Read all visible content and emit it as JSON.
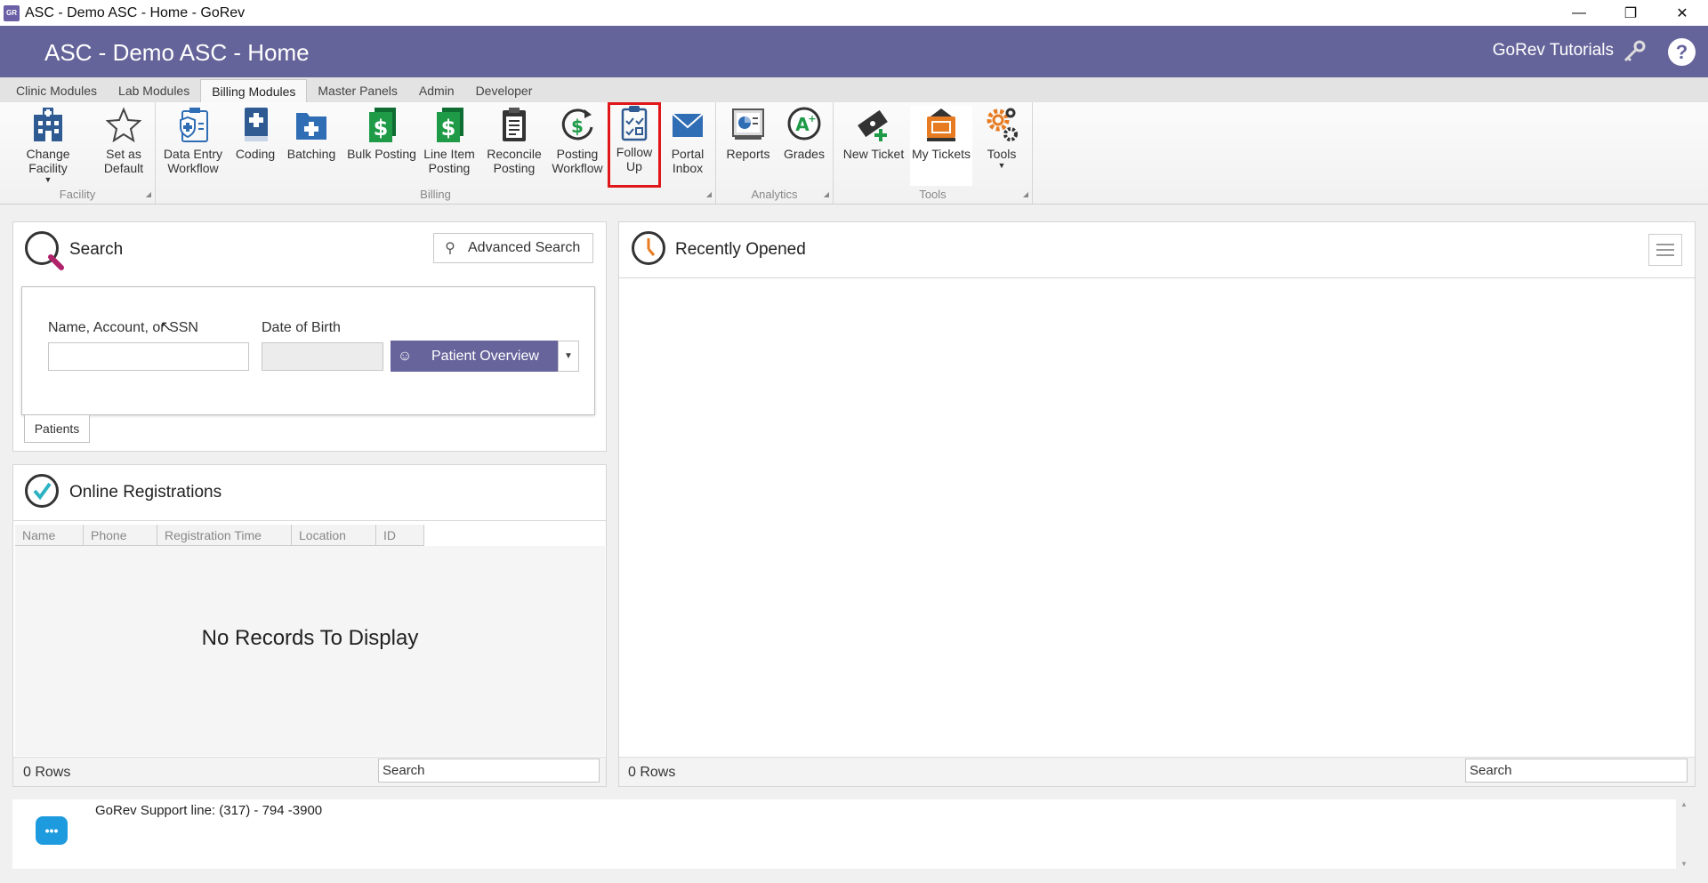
{
  "window": {
    "app_icon": "gorev-app-icon",
    "title": "ASC - Demo ASC - Home - GoRev",
    "controls": [
      "minimize-icon",
      "restore-icon",
      "close-icon"
    ]
  },
  "header": {
    "title": "ASC - Demo ASC - Home",
    "tutorials_label": "GoRev Tutorials",
    "help_label": "?"
  },
  "tabs": [
    {
      "label": "Clinic Modules",
      "active": false
    },
    {
      "label": "Lab Modules",
      "active": false
    },
    {
      "label": "Billing Modules",
      "active": true
    },
    {
      "label": "Master Panels",
      "active": false
    },
    {
      "label": "Admin",
      "active": false
    },
    {
      "label": "Developer",
      "active": false
    }
  ],
  "ribbon": {
    "groups": {
      "facility": "Facility",
      "billing": "Billing",
      "analytics": "Analytics",
      "tools": "Tools"
    },
    "buttons": {
      "change_facility": [
        "Change Facility"
      ],
      "set_default": [
        "Set as",
        "Default"
      ],
      "data_entry": [
        "Data Entry",
        "Workflow"
      ],
      "coding": [
        "Coding"
      ],
      "batching": [
        "Batching"
      ],
      "bulk_posting": [
        "Bulk Posting"
      ],
      "line_item": [
        "Line Item",
        "Posting"
      ],
      "reconcile": [
        "Reconcile",
        "Posting"
      ],
      "posting_workflow": [
        "Posting",
        "Workflow"
      ],
      "follow_up": [
        "Follow",
        "Up"
      ],
      "portal_inbox": [
        "Portal",
        "Inbox"
      ],
      "reports": [
        "Reports"
      ],
      "grades": [
        "Grades"
      ],
      "new_ticket": [
        "New Ticket"
      ],
      "my_tickets": [
        "My Tickets"
      ],
      "tools": [
        "Tools"
      ]
    },
    "highlighted": "follow_up"
  },
  "search_panel": {
    "title": "Search",
    "advanced_label": "Advanced Search",
    "name_label": "Name, Account, or SSN",
    "name_value": "",
    "dob_label": "Date of Birth",
    "dob_value": "",
    "patient_overview_label": "Patient Overview",
    "patients_tab": "Patients"
  },
  "online_registrations": {
    "title": "Online Registrations",
    "columns": [
      "Name",
      "Phone",
      "Registration Time",
      "Location",
      "ID"
    ],
    "empty_text": "No Records To Display",
    "rows_text": "0 Rows",
    "search_placeholder": "Search"
  },
  "recently_opened": {
    "title": "Recently Opened",
    "rows_text": "0 Rows",
    "search_placeholder": "Search"
  },
  "support": {
    "text": "GoRev Support line: (317) - 794 -3900"
  },
  "colors": {
    "header_bg": "#65649a",
    "accent_button": "#67649c",
    "highlight_border": "#e0161a",
    "dollar_green": "#1f9b48",
    "doc_blue": "#2f6db5",
    "tools_orange": "#e67b22"
  }
}
